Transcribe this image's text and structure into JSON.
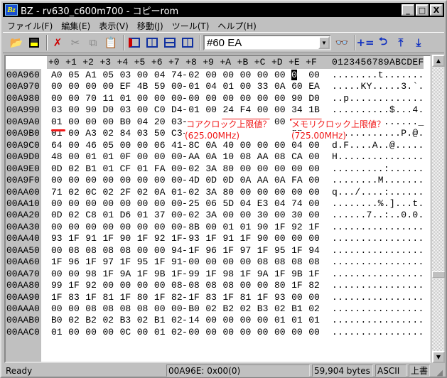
{
  "window": {
    "title": "BZ - rv630_c600m700 - コピーrom",
    "icon_text": "Bz",
    "min": "_",
    "max": "□",
    "close": "X"
  },
  "menu": [
    "ファイル(F)",
    "編集(E)",
    "表示(V)",
    "移動(J)",
    "ツール(T)",
    "ヘルプ(H)"
  ],
  "toolbar": {
    "search_value": "#60 EA",
    "icons": [
      "open-folder-icon",
      "save-icon",
      "delete-icon",
      "cut-icon",
      "copy-icon",
      "paste-icon",
      "view1-icon",
      "view2-icon",
      "view3-icon",
      "view4-icon",
      "binoculars-icon",
      "calc-icon",
      "undo-jump-icon",
      "goto-top-icon",
      "goto-bottom-icon"
    ],
    "calc_label": "+=",
    "undo_glyph": "⮌",
    "top_glyph": "⤒",
    "bottom_glyph": "⤓"
  },
  "hex": {
    "columns": [
      "+0",
      "+1",
      "+2",
      "+3",
      "+4",
      "+5",
      "+6",
      "+7",
      "+8",
      "+9",
      "+A",
      "+B",
      "+C",
      "+D",
      "+E",
      "+F"
    ],
    "ascii_header": "0123456789ABCDEF",
    "cursor": {
      "row": 0,
      "col": 14
    },
    "rows": [
      {
        "addr": "00A960",
        "bytes": [
          "A0",
          "05",
          "A1",
          "05",
          "03",
          "00",
          "04",
          "74",
          "02",
          "00",
          "00",
          "00",
          "00",
          "00",
          "00",
          "00"
        ],
        "ascii": "........t......."
      },
      {
        "addr": "00A970",
        "bytes": [
          "00",
          "00",
          "00",
          "00",
          "EF",
          "4B",
          "59",
          "00",
          "01",
          "04",
          "01",
          "00",
          "33",
          "0A",
          "60",
          "EA"
        ],
        "ascii": ".....KY.....3.`."
      },
      {
        "addr": "00A980",
        "bytes": [
          "00",
          "00",
          "70",
          "11",
          "01",
          "00",
          "00",
          "00",
          "00",
          "00",
          "00",
          "00",
          "00",
          "00",
          "90",
          "D0"
        ],
        "ascii": "..p............."
      },
      {
        "addr": "00A990",
        "bytes": [
          "03",
          "00",
          "90",
          "D0",
          "03",
          "00",
          "C0",
          "D4",
          "01",
          "00",
          "24",
          "F4",
          "00",
          "00",
          "34",
          "1B"
        ],
        "ascii": "..........$...4."
      },
      {
        "addr": "00A9A0",
        "bytes": [
          "01",
          "00",
          "00",
          "00",
          "B0",
          "04",
          "20",
          "03",
          "",
          "",
          "",
          "",
          "",
          "00",
          "",
          ""
        ],
        "ascii": "..............._"
      },
      {
        "addr": "00A9B0",
        "bytes": [
          "01",
          "00",
          "A3",
          "02",
          "84",
          "03",
          "50",
          "C3",
          "",
          "",
          "",
          "",
          "",
          "",
          "C3",
          ""
        ],
        "ascii": "............P.@."
      },
      {
        "addr": "00A9C0",
        "bytes": [
          "64",
          "00",
          "46",
          "05",
          "00",
          "00",
          "06",
          "41",
          "8C",
          "0A",
          "40",
          "00",
          "00",
          "00",
          "04",
          "00"
        ],
        "ascii": "d.F....A..@....."
      },
      {
        "addr": "00A9D0",
        "bytes": [
          "48",
          "00",
          "01",
          "01",
          "0F",
          "00",
          "00",
          "00",
          "AA",
          "0A",
          "10",
          "08",
          "AA",
          "08",
          "CA",
          "00"
        ],
        "ascii": "H..............."
      },
      {
        "addr": "00A9E0",
        "bytes": [
          "0D",
          "02",
          "B1",
          "01",
          "CF",
          "01",
          "FA",
          "00",
          "02",
          "3A",
          "80",
          "00",
          "00",
          "00",
          "00",
          "00"
        ],
        "ascii": ".........:......"
      },
      {
        "addr": "00A9F0",
        "bytes": [
          "00",
          "00",
          "00",
          "00",
          "00",
          "00",
          "00",
          "00",
          "4D",
          "0D",
          "0D",
          "0A",
          "AA",
          "0A",
          "FA",
          "00"
        ],
        "ascii": "........M......."
      },
      {
        "addr": "00AA00",
        "bytes": [
          "71",
          "02",
          "0C",
          "02",
          "2F",
          "02",
          "0A",
          "01",
          "02",
          "3A",
          "80",
          "00",
          "00",
          "00",
          "00",
          "00"
        ],
        "ascii": "q.../....:......"
      },
      {
        "addr": "00AA10",
        "bytes": [
          "00",
          "00",
          "00",
          "00",
          "00",
          "00",
          "00",
          "00",
          "25",
          "06",
          "5D",
          "04",
          "E3",
          "04",
          "74",
          "00"
        ],
        "ascii": "........%.]...t."
      },
      {
        "addr": "00AA20",
        "bytes": [
          "0D",
          "02",
          "C8",
          "01",
          "D6",
          "01",
          "37",
          "00",
          "02",
          "3A",
          "00",
          "00",
          "30",
          "00",
          "30",
          "00"
        ],
        "ascii": "......7..:..0.0."
      },
      {
        "addr": "00AA30",
        "bytes": [
          "00",
          "00",
          "00",
          "00",
          "00",
          "00",
          "00",
          "00",
          "8B",
          "00",
          "01",
          "01",
          "90",
          "1F",
          "92",
          "1F"
        ],
        "ascii": "................"
      },
      {
        "addr": "00AA40",
        "bytes": [
          "93",
          "1F",
          "91",
          "1F",
          "90",
          "1F",
          "92",
          "1F",
          "93",
          "1F",
          "91",
          "1F",
          "90",
          "00",
          "00",
          "00"
        ],
        "ascii": "................"
      },
      {
        "addr": "00AA50",
        "bytes": [
          "00",
          "08",
          "08",
          "08",
          "08",
          "00",
          "00",
          "94",
          "1F",
          "96",
          "1F",
          "97",
          "1F",
          "95",
          "1F",
          "94"
        ],
        "ascii": "................"
      },
      {
        "addr": "00AA60",
        "bytes": [
          "1F",
          "96",
          "1F",
          "97",
          "1F",
          "95",
          "1F",
          "91",
          "00",
          "00",
          "00",
          "00",
          "08",
          "08",
          "08",
          "08"
        ],
        "ascii": "................"
      },
      {
        "addr": "00AA70",
        "bytes": [
          "00",
          "00",
          "98",
          "1F",
          "9A",
          "1F",
          "9B",
          "1F",
          "99",
          "1F",
          "98",
          "1F",
          "9A",
          "1F",
          "9B",
          "1F"
        ],
        "ascii": "................"
      },
      {
        "addr": "00AA80",
        "bytes": [
          "99",
          "1F",
          "92",
          "00",
          "00",
          "00",
          "00",
          "08",
          "08",
          "08",
          "08",
          "00",
          "00",
          "80",
          "1F",
          "82"
        ],
        "ascii": "................"
      },
      {
        "addr": "00AA90",
        "bytes": [
          "1F",
          "83",
          "1F",
          "81",
          "1F",
          "80",
          "1F",
          "82",
          "1F",
          "83",
          "1F",
          "81",
          "1F",
          "93",
          "00",
          "00"
        ],
        "ascii": "................"
      },
      {
        "addr": "00AAA0",
        "bytes": [
          "00",
          "00",
          "08",
          "08",
          "08",
          "08",
          "00",
          "00",
          "B0",
          "02",
          "B2",
          "02",
          "B3",
          "02",
          "B1",
          "02"
        ],
        "ascii": "................"
      },
      {
        "addr": "00AAB0",
        "bytes": [
          "B0",
          "02",
          "B2",
          "02",
          "B3",
          "02",
          "B1",
          "02",
          "14",
          "00",
          "00",
          "00",
          "00",
          "01",
          "01",
          "01"
        ],
        "ascii": "................"
      },
      {
        "addr": "00AAC0",
        "bytes": [
          "01",
          "00",
          "00",
          "00",
          "0C",
          "00",
          "01",
          "02",
          "00",
          "00",
          "00",
          "00",
          "00",
          "00",
          "00",
          "00"
        ],
        "ascii": "................"
      }
    ]
  },
  "annotations": {
    "core_label": "コアクロック上限値？",
    "core_value": "(625.00MHz)",
    "mem_label": "メモリクロック上限値？",
    "mem_value": "(725.00MHz)",
    "color": "#f01818"
  },
  "status": {
    "ready": "Ready",
    "position": "00A96E: 0x00(0)",
    "size": "59,904 bytes",
    "encoding": "ASCII",
    "mode": "上書"
  }
}
